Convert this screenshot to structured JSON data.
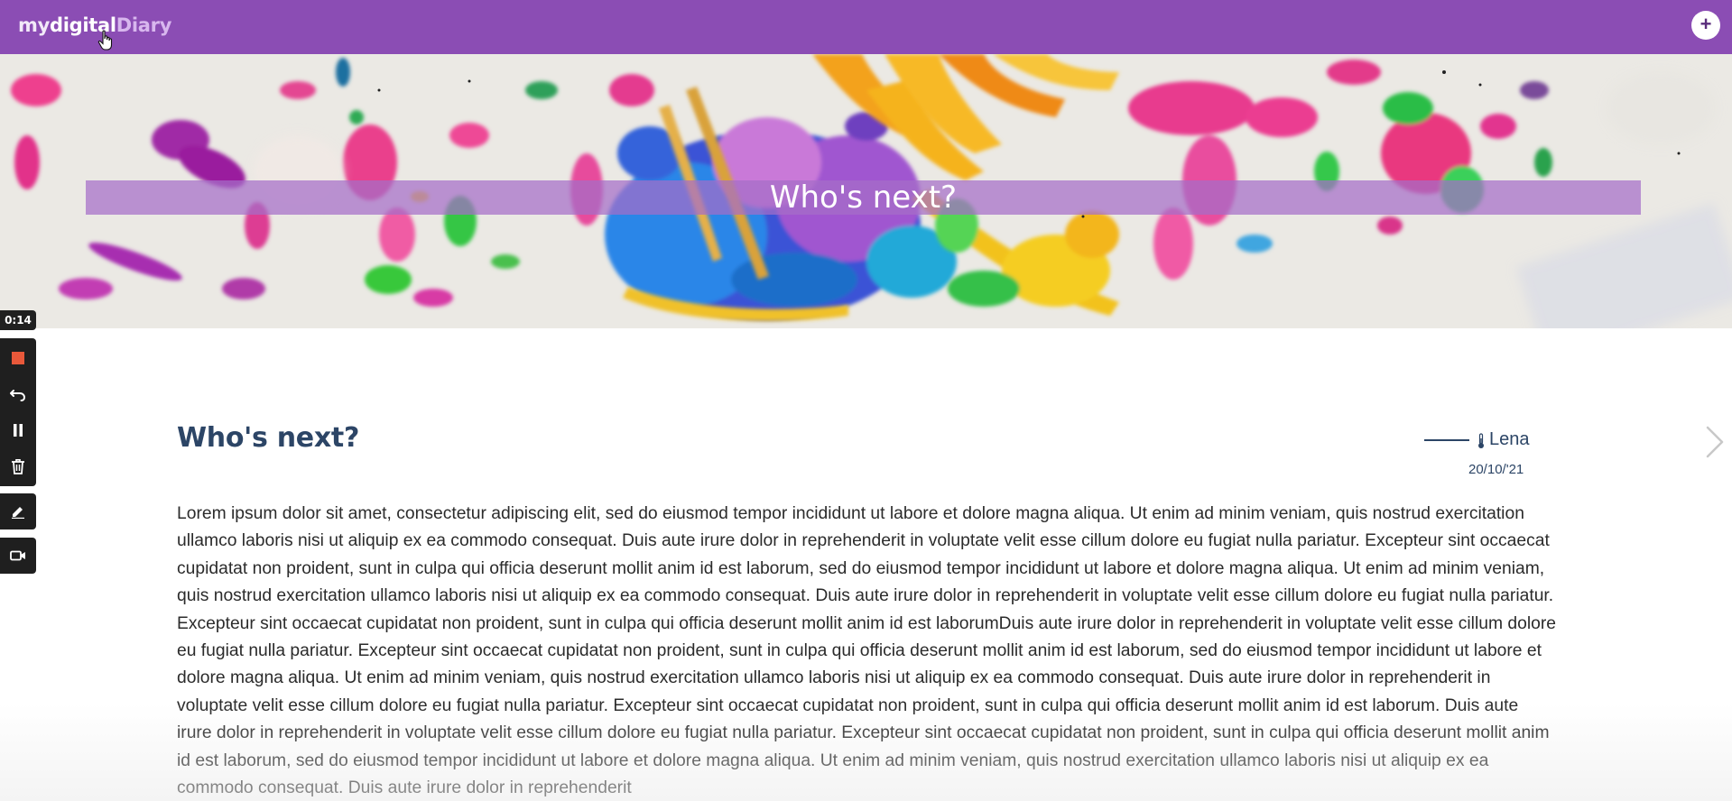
{
  "app": {
    "logo_part1": "my",
    "logo_part2": "digital",
    "logo_part3": "Diary",
    "add_button_label": "+"
  },
  "hero": {
    "title": "Who's next?"
  },
  "recorder": {
    "elapsed": "0:14",
    "buttons": [
      "stop-icon",
      "undo-icon",
      "pause-icon",
      "trash-icon",
      "pen-icon",
      "video-camera-icon"
    ]
  },
  "post": {
    "title": "Who's next?",
    "author": "Lena",
    "date": "20/10/'21",
    "body": "Lorem ipsum dolor sit amet, consectetur adipiscing elit, sed do eiusmod tempor incididunt ut labore et dolore magna aliqua. Ut enim ad minim veniam, quis nostrud exercitation ullamco laboris nisi ut aliquip ex ea commodo consequat. Duis aute irure dolor in reprehenderit in voluptate velit esse cillum dolore eu fugiat nulla pariatur. Excepteur sint occaecat cupidatat non proident, sunt in culpa qui officia deserunt mollit anim id est laborum, sed do eiusmod tempor incididunt ut labore et dolore magna aliqua. Ut enim ad minim veniam, quis nostrud exercitation ullamco laboris nisi ut aliquip ex ea commodo consequat. Duis aute irure dolor in reprehenderit in voluptate velit esse cillum dolore eu fugiat nulla pariatur. Excepteur sint occaecat cupidatat non proident, sunt in culpa qui officia deserunt mollit anim id est laborumDuis aute irure dolor in reprehenderit in voluptate velit esse cillum dolore eu fugiat nulla pariatur. Excepteur sint occaecat cupidatat non proident, sunt in culpa qui officia deserunt mollit anim id est laborum, sed do eiusmod tempor incididunt ut labore et dolore magna aliqua. Ut enim ad minim veniam, quis nostrud exercitation ullamco laboris nisi ut aliquip ex ea commodo consequat. Duis aute irure dolor in reprehenderit in voluptate velit esse cillum dolore eu fugiat nulla pariatur. Excepteur sint occaecat cupidatat non proident, sunt in culpa qui officia deserunt mollit anim id est laborum. Duis aute irure dolor in reprehenderit in voluptate velit esse cillum dolore eu fugiat nulla pariatur. Excepteur sint occaecat cupidatat non proident, sunt in culpa qui officia deserunt mollit anim id est laborum, sed do eiusmod tempor incididunt ut labore et dolore magna aliqua. Ut enim ad minim veniam, quis nostrud exercitation ullamco laboris nisi ut aliquip ex ea commodo consequat. Duis aute irure dolor in reprehenderit"
  },
  "colors": {
    "topbar": "#8b4db4",
    "title_blue": "#2c4566",
    "recorder_bg": "#1f1f1f",
    "stop_red": "#e8583a"
  }
}
